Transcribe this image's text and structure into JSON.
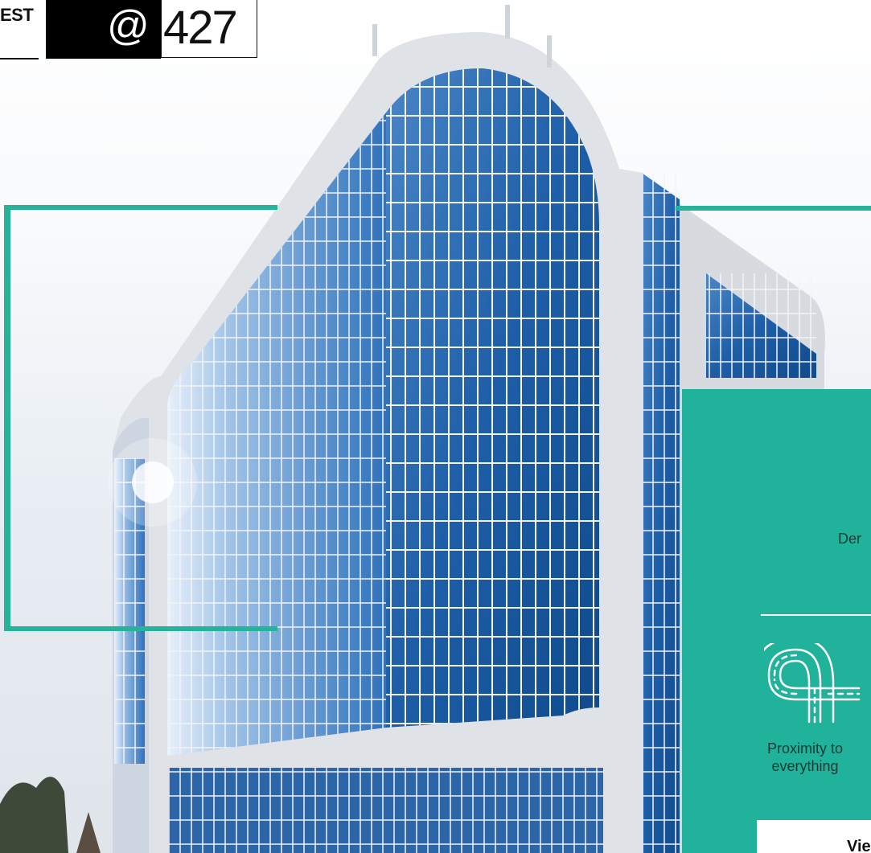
{
  "logo": {
    "left_text": "EST",
    "at_symbol": "@",
    "number": "427"
  },
  "panel": {
    "text_1": "Der",
    "text_2": "Proximity to everything",
    "button_label": "Vie",
    "icon": "road-interchange-icon"
  },
  "colors": {
    "accent": "#27b39a",
    "panel": "#20b29a",
    "logo_black": "#000000"
  }
}
